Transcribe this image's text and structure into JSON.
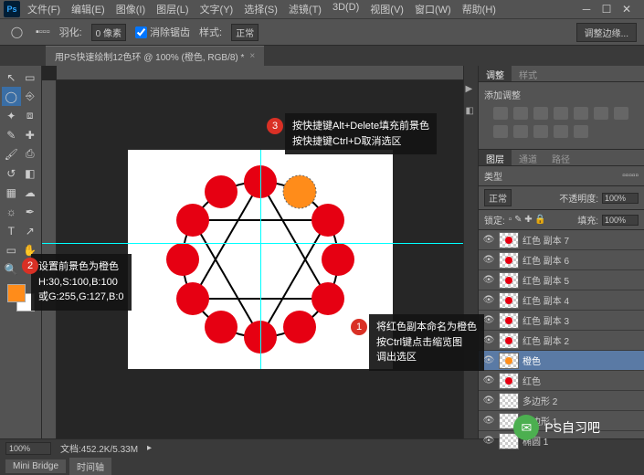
{
  "menuItems": [
    "文件(F)",
    "编辑(E)",
    "图像(I)",
    "图层(L)",
    "文字(Y)",
    "选择(S)",
    "滤镜(T)",
    "3D(D)",
    "视图(V)",
    "窗口(W)",
    "帮助(H)"
  ],
  "featherLabel": "羽化:",
  "featherValue": "0 像素",
  "antiAlias": "消除锯齿",
  "styleLabel": "样式:",
  "styleValue": "正常",
  "optButton": "调整边缘...",
  "docTab": "用PS快速绘制12色环 @ 100% (橙色, RGB/8) *",
  "panelTabs": {
    "adj": "调整",
    "style": "样式"
  },
  "adjTitle": "添加调整",
  "layerTabs": [
    "图层",
    "通道",
    "路径"
  ],
  "typeLabel": "类型",
  "blendMode": "正常",
  "opacityLabel": "不透明度:",
  "opacityValue": "100%",
  "lockLabel": "锁定:",
  "fillLabel": "填充:",
  "fillValue": "100%",
  "layers": [
    {
      "name": "红色 副本 7",
      "color": "#e60012"
    },
    {
      "name": "红色 副本 6",
      "color": "#e60012"
    },
    {
      "name": "红色 副本 5",
      "color": "#e60012"
    },
    {
      "name": "红色 副本 4",
      "color": "#e60012"
    },
    {
      "name": "红色 副本 3",
      "color": "#e60012"
    },
    {
      "name": "红色 副本 2",
      "color": "#e60012"
    },
    {
      "name": "橙色",
      "selected": true,
      "color": "#ff8c1a"
    },
    {
      "name": "红色",
      "color": "#e60012"
    },
    {
      "name": "多边形 2",
      "color": ""
    },
    {
      "name": "多边形 1",
      "color": ""
    },
    {
      "name": "椭圆 1",
      "color": ""
    }
  ],
  "zoom": "100%",
  "docInfo": "文档:452.2K/5.33M",
  "bottomTabs": [
    "Mini Bridge",
    "时间轴"
  ],
  "callout1": {
    "l1": "将红色副本命名为橙色",
    "l2": "按Ctrl键点击缩览图",
    "l3": "调出选区"
  },
  "callout2": {
    "l1": "设置前景色为橙色",
    "l2": "H:30,S:100,B:100",
    "l3": "或G:255,G:127,B:0"
  },
  "callout3": {
    "l1": "按快捷键Alt+Delete填充前景色",
    "l2": "按快捷键Ctrl+D取消选区"
  },
  "fgColor": "#ff8c1a",
  "watermark": "PS自习吧"
}
